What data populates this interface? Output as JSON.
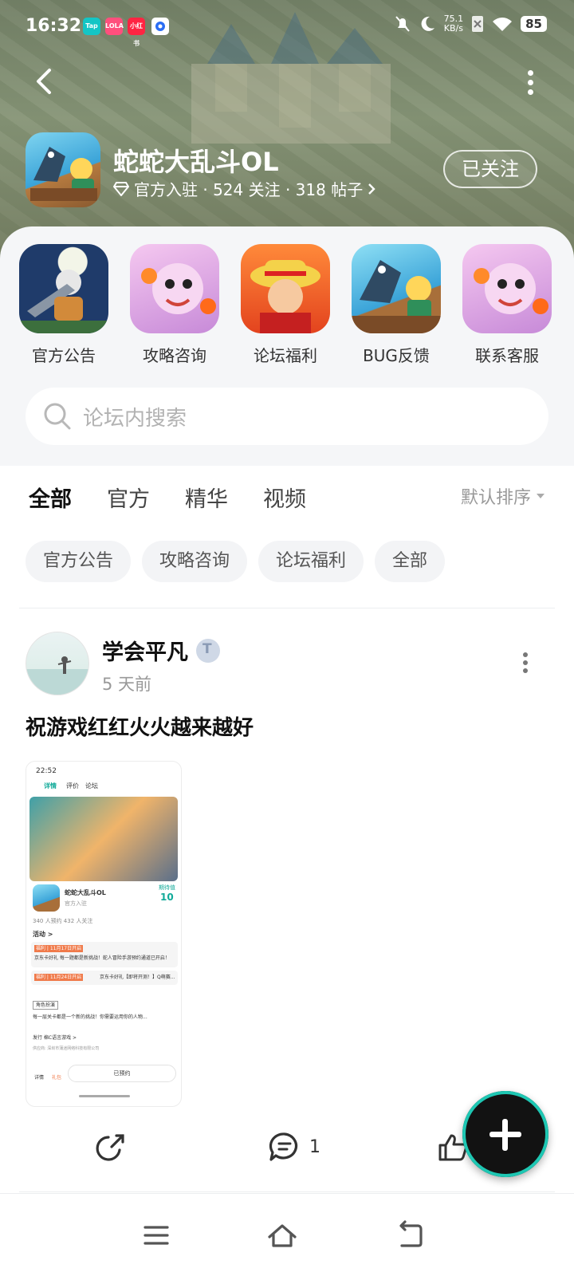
{
  "status_bar": {
    "time": "16:32",
    "app_badges": [
      {
        "text": "Tap",
        "color": "#14c5c5"
      },
      {
        "text": "LOLA",
        "color": "#ff4f7d"
      },
      {
        "text": "小红书",
        "color": "#ff2442"
      },
      {
        "text": "",
        "color": "#2a6df4"
      }
    ],
    "net_speed_value": "75.1",
    "net_speed_unit": "KB/s",
    "battery": "85"
  },
  "header": {
    "game_name": "蛇蛇大乱斗OL",
    "meta": "官方入驻 · 524 关注 · 318 帖子",
    "follow_label": "已关注",
    "back_icon": "chevron-left-icon",
    "more_icon": "more-vertical-icon"
  },
  "shortcuts": [
    {
      "label": "官方公告",
      "icon": "announcement-art"
    },
    {
      "label": "攻略咨询",
      "icon": "guide-art"
    },
    {
      "label": "论坛福利",
      "icon": "welfare-art"
    },
    {
      "label": "BUG反馈",
      "icon": "bug-feedback-art"
    },
    {
      "label": "联系客服",
      "icon": "customer-service-art"
    }
  ],
  "search": {
    "placeholder": "论坛内搜索"
  },
  "tabs": [
    {
      "label": "全部",
      "active": true
    },
    {
      "label": "官方",
      "active": false
    },
    {
      "label": "精华",
      "active": false
    },
    {
      "label": "视频",
      "active": false
    }
  ],
  "sort_label": "默认排序",
  "chips": [
    "官方公告",
    "攻略咨询",
    "论坛福利",
    "全部"
  ],
  "post": {
    "author": "学会平凡",
    "time": "5 天前",
    "title": "祝游戏红红火火越来越好",
    "comment_count": "1",
    "screenshot": {
      "time": "22:52",
      "tabs": [
        "详情",
        "评价",
        "论坛"
      ],
      "game_name": "蛇蛇大乱斗OL",
      "official": "官方入驻",
      "score_label": "期待值",
      "score": "10",
      "stats": "340 人预约   432 人关注",
      "activity_label": "活动 >",
      "news1_tag": "福利 | 11月17日开启",
      "news1": "京东卡好礼 每一题都是新挑战！蛇人冒险手游预约通道已开启！",
      "news2_tag": "福利 | 11月24日开启",
      "news2": "京东卡好礼【即将开测！】Q萌赛...",
      "desc_tag": "角色扮演",
      "desc": "每一层关卡都是一个新的挑战！你需要运用你的人物...",
      "publisher": "发行 棉C语言游戏 >",
      "developer": "供应商: 深圳市蒲迷网络科技有限公司",
      "btn_left1": "详情",
      "btn_left2": "礼包",
      "reserve_btn": "已预约"
    }
  },
  "colors": {
    "accent": "#22c7b4",
    "tab_underline": "#22c7b4"
  }
}
